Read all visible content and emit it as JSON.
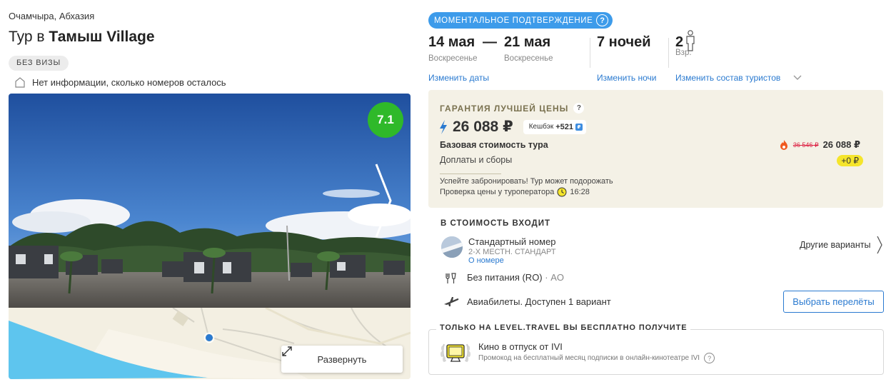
{
  "hotel": {
    "location": "Очамчыра, Абхазия",
    "title_prefix": "Тур в ",
    "title_name": "Тамыш Village",
    "visa_badge": "БЕЗ ВИЗЫ",
    "rooms_info": "Нет информации, сколько номеров осталось",
    "rating": "7.1",
    "rating_color": "#2fb92a",
    "expand_label": "Развернуть"
  },
  "booking": {
    "instant_badge": "МОМЕНТАЛЬНОЕ ПОДТВЕРЖДЕНИЕ",
    "date_from": "14 мая",
    "date_from_day": "Воскресенье",
    "dash": "—",
    "date_to": "21 мая",
    "date_to_day": "Воскресенье",
    "nights": "7 ночей",
    "adults_count": "2",
    "adults_label": "Взр.",
    "change_dates": "Изменить даты",
    "change_nights": "Изменить ночи",
    "change_tourists": "Изменить состав туристов"
  },
  "price": {
    "guarantee": "ГАРАНТИЯ ЛУЧШЕЙ ЦЕНЫ",
    "total": "26 088 ₽",
    "cashback_label": "Кешбэк",
    "cashback_value": "+521",
    "base_label": "Базовая стоимость тура",
    "base_old": "36 546 ₽",
    "base_new": "26 088 ₽",
    "fees_label": "Доплаты и сборы",
    "fees_value": "+0 ₽",
    "note_hurry": "Успейте забронировать! Тур может подорожать",
    "note_check": "Проверка цены у туроператора",
    "note_time": "16:28",
    "accent_color": "#f5e52b"
  },
  "includes": {
    "title": "В СТОИМОСТЬ ВХОДИТ",
    "room_name": "Стандартный номер",
    "room_sub": "2-Х МЕСТН. СТАНДАРТ",
    "room_link": "О номере",
    "other_variants": "Другие варианты",
    "meal": "Без питания (RO)",
    "meal_code": " · AO",
    "flights": "Авиабилеты. Доступен 1 вариант",
    "flights_button": "Выбрать перелёты"
  },
  "gift": {
    "title": "ТОЛЬКО НА LEVEL.TRAVEL ВЫ БЕСПЛАТНО ПОЛУЧИТЕ",
    "name": "Кино в отпуск от IVI",
    "desc": "Промокод на бесплатный месяц подписки в онлайн-кинотеатре IVI"
  },
  "icons": {
    "rooms": "door-icon",
    "next": "chevron-right-icon",
    "expand": "expand-arrows-icon",
    "help": "question-icon",
    "person": "person-icon",
    "lightning": "lightning-icon",
    "fire": "fire-icon",
    "clock": "clock-icon",
    "meal": "cutlery-icon",
    "plane": "plane-icon",
    "gift": "tv-laurel-icon"
  }
}
